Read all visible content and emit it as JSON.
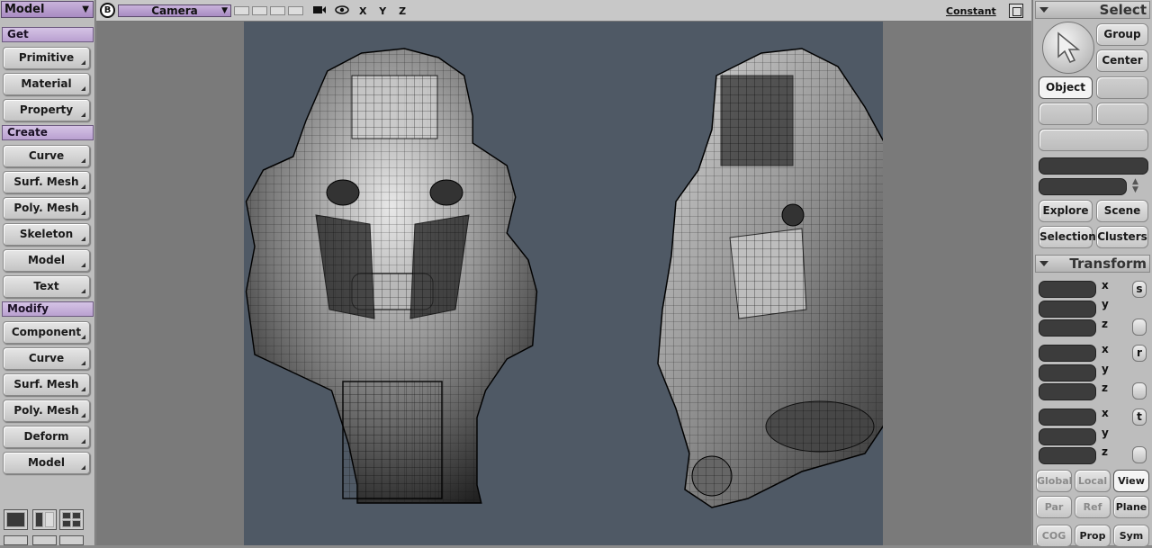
{
  "left_panel": {
    "mode_label": "Model",
    "sections": [
      {
        "title": "Get",
        "items": [
          "Primitive",
          "Material",
          "Property"
        ]
      },
      {
        "title": "Create",
        "items": [
          "Curve",
          "Surf. Mesh",
          "Poly. Mesh",
          "Skeleton",
          "Model",
          "Text"
        ]
      },
      {
        "title": "Modify",
        "items": [
          "Component",
          "Curve",
          "Surf. Mesh",
          "Poly. Mesh",
          "Deform",
          "Model"
        ]
      }
    ]
  },
  "top_bar": {
    "b_label": "B",
    "camera_label": "Camera",
    "axes_label": "X Y Z",
    "mode_label": "Constant"
  },
  "right_panel": {
    "select_title": "Select",
    "group_label": "Group",
    "center_label": "Center",
    "object_label": "Object",
    "explore_label": "Explore",
    "scene_label": "Scene",
    "selection_label": "Selection",
    "clusters_label": "Clusters",
    "transform_title": "Transform",
    "axis_x": "x",
    "axis_y": "y",
    "axis_z": "z",
    "scale_glyph": "s",
    "rotate_glyph": "r",
    "translate_glyph": "t",
    "global_label": "Global",
    "local_label": "Local",
    "view_label": "View",
    "par_label": "Par",
    "ref_label": "Ref",
    "plane_label": "Plane",
    "cog_label": "COG",
    "prop_label": "Prop",
    "sym_label": "Sym"
  }
}
